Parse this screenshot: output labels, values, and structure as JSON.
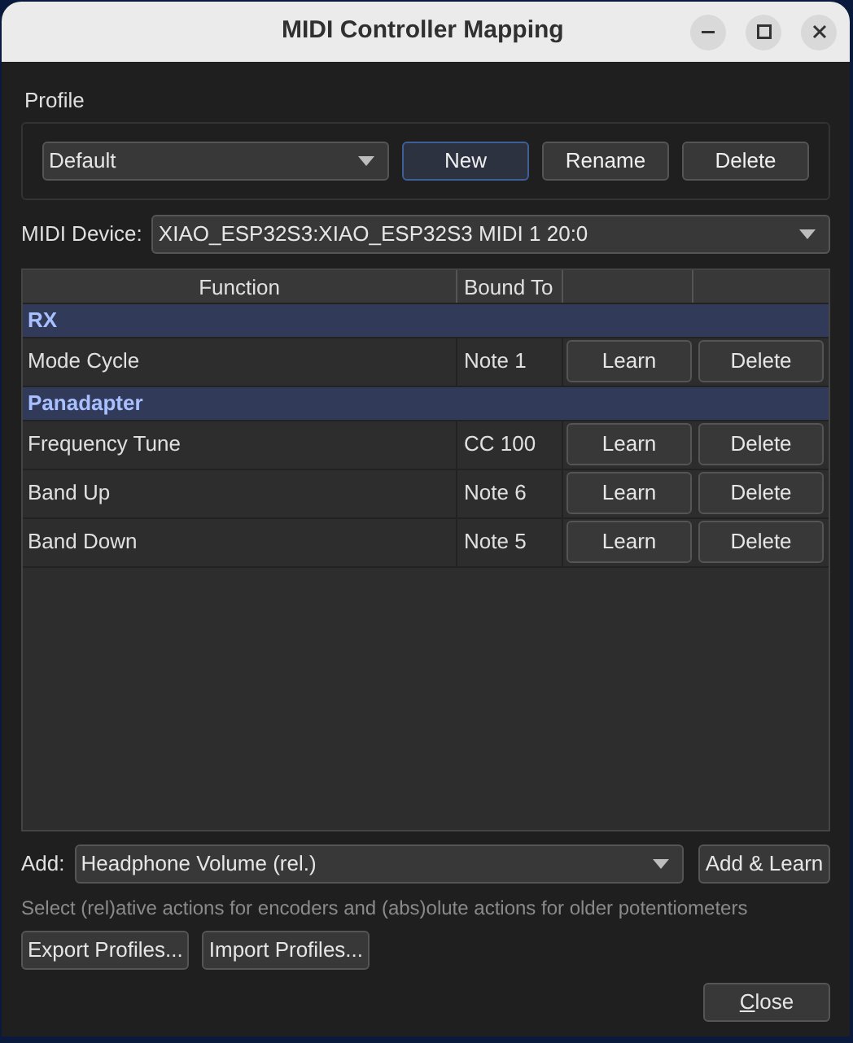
{
  "window": {
    "title": "MIDI Controller Mapping"
  },
  "profile": {
    "label": "Profile",
    "value": "Default",
    "buttons": [
      {
        "label": "New",
        "focused": true
      },
      {
        "label": "Rename",
        "focused": false
      },
      {
        "label": "Delete",
        "focused": false
      }
    ]
  },
  "device": {
    "label": "MIDI Device:",
    "value": "XIAO_ESP32S3:XIAO_ESP32S3 MIDI 1 20:0"
  },
  "table": {
    "columns": [
      "Function",
      "Bound To"
    ],
    "rows": [
      {
        "kind": "group",
        "label": "RX"
      },
      {
        "kind": "binding",
        "function": "Mode Cycle",
        "bound_to": "Note 1",
        "learn": "Learn",
        "delete": "Delete"
      },
      {
        "kind": "group",
        "label": "Panadapter"
      },
      {
        "kind": "binding",
        "function": "Frequency Tune",
        "bound_to": "CC 100",
        "learn": "Learn",
        "delete": "Delete"
      },
      {
        "kind": "binding",
        "function": "Band Up",
        "bound_to": "Note 6",
        "learn": "Learn",
        "delete": "Delete"
      },
      {
        "kind": "binding",
        "function": "Band Down",
        "bound_to": "Note 5",
        "learn": "Learn",
        "delete": "Delete"
      }
    ]
  },
  "add": {
    "label": "Add:",
    "value": "Headphone Volume (rel.)",
    "button": "Add & Learn"
  },
  "hint": "Select (rel)ative actions for encoders and (abs)olute actions for older potentiometers",
  "export_buttons": [
    "Export Profiles...",
    "Import Profiles..."
  ],
  "close": {
    "label": "Close",
    "mnemonic_underlined": true
  }
}
